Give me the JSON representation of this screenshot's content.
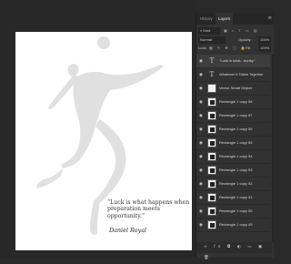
{
  "panel": {
    "tabs": [
      {
        "label": "History"
      },
      {
        "label": "Layers"
      }
    ],
    "menu_glyph": "≡",
    "filter": {
      "kind": "Kind"
    },
    "blend": {
      "mode": "Normal",
      "opacity_label": "Opacity:",
      "opacity": "100%"
    },
    "lock": {
      "label": "Lock:",
      "fill_label": "Fill:",
      "fill": "100%"
    },
    "layers": [
      {
        "label": "\"Luck is what...rtunity.\"",
        "kind": "text"
      },
      {
        "label": "Whatever It Takes Together",
        "kind": "text"
      },
      {
        "label": "Vector Smart Object",
        "kind": "image"
      },
      {
        "label": "Rectangle 1 copy 58",
        "kind": "image"
      },
      {
        "label": "Rectangle 1 copy 57",
        "kind": "image"
      },
      {
        "label": "Rectangle 1 copy 56",
        "kind": "image"
      },
      {
        "label": "Rectangle 1 copy 55",
        "kind": "image"
      },
      {
        "label": "Rectangle 1 copy 54",
        "kind": "image"
      },
      {
        "label": "Rectangle 1 copy 53",
        "kind": "image"
      },
      {
        "label": "Rectangle 1 copy 52",
        "kind": "image"
      },
      {
        "label": "Rectangle 1 copy 51",
        "kind": "image"
      },
      {
        "label": "Rectangle 1 copy 50",
        "kind": "image"
      },
      {
        "label": "Rectangle 1 copy 49",
        "kind": "image"
      }
    ],
    "bottom_icons": "∞ fx ◘ ◐ ▭ ▣ 🗑"
  },
  "document": {
    "quote": "“Luck is what happens when preparation meets opportunity.”",
    "signature": "Daniel Royal",
    "silhouette_color": "#e0e0e0"
  },
  "colors": {
    "canvas_bg": "#282828",
    "panel_bg": "#323232",
    "document_bg": "#ffffff"
  }
}
